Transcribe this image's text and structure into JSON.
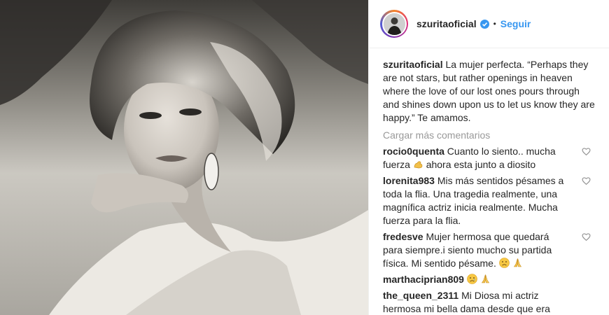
{
  "post": {
    "username": "szuritaoficial",
    "follow_label": "Seguir",
    "separator": "•",
    "caption_text": "La mujer perfecta. “Perhaps they are not stars, but rather openings in heaven where the love of our lost ones pours through and shines down upon us to let us know they are happy.” Te amamos.",
    "load_more_label": "Cargar más comentarios"
  },
  "comments": [
    {
      "user": "rocio0quenta",
      "text_a": "Cuanto lo siento.. mucha fuerza ",
      "text_b": " ahora esta junto a diosito",
      "emoji": "flexed-biceps"
    },
    {
      "user": "lorenita983",
      "text_a": "Mis más sentidos pésames a toda la flia. Una tragedia realmente, una magnífica actriz inicia realmente. Mucha fuerza para la flia.",
      "text_b": "",
      "emoji": ""
    },
    {
      "user": "fredesve",
      "text_a": "Mujer hermosa que quedará para siempre.i siento mucho su partida física. Mi sentido pésame. ",
      "text_b": "",
      "emoji": "sad-face, praying-hands"
    },
    {
      "user": "marthaciprian809",
      "text_a": " ",
      "text_b": "",
      "emoji": "crying-face, praying-hands"
    },
    {
      "user": "the_queen_2311",
      "text_a": "Mi Diosa mi actriz hermosa mi bella dama desde que era",
      "text_b": "",
      "emoji": ""
    }
  ],
  "colors": {
    "link": "#3897f0",
    "muted": "#999999",
    "text": "#262626"
  }
}
